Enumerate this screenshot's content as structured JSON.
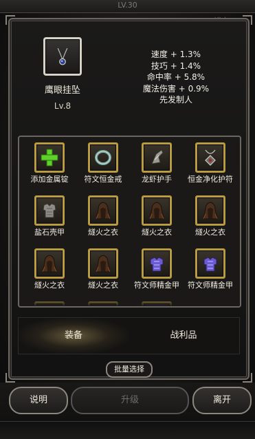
{
  "header": {
    "level": "LV.30",
    "right_text": "锁定"
  },
  "item": {
    "icon": "pendant-icon",
    "name": "鹰眼挂坠",
    "level": "Lv.8"
  },
  "stats": [
    "速度 + 1.3%",
    "技巧 + 1.4%",
    "命中率 + 5.8%",
    "魔法伤害 + 0.9%",
    "先发制人"
  ],
  "grid": [
    {
      "label": "添加金属锭",
      "icon": "plus-icon"
    },
    {
      "label": "符文恒金戒",
      "icon": "ring-icon"
    },
    {
      "label": "龙虾护手",
      "icon": "gauntlet-icon"
    },
    {
      "label": "恒金净化护符",
      "icon": "amulet-icon"
    },
    {
      "label": "盐石壳甲",
      "icon": "chest-armor-icon"
    },
    {
      "label": "燧火之衣",
      "icon": "cloak-icon"
    },
    {
      "label": "燧火之衣",
      "icon": "cloak-icon"
    },
    {
      "label": "燧火之衣",
      "icon": "cloak-icon"
    },
    {
      "label": "燧火之衣",
      "icon": "cloak-icon"
    },
    {
      "label": "燧火之衣",
      "icon": "cloak-icon"
    },
    {
      "label": "符文师精金甲",
      "icon": "rune-armor-icon"
    },
    {
      "label": "符文师精金甲",
      "icon": "rune-armor-icon"
    }
  ],
  "tabs": {
    "equipment": "装备",
    "loot": "战利品"
  },
  "batch_select": "批量选择",
  "buttons": {
    "help": "说明",
    "upgrade": "升级",
    "leave": "离开"
  },
  "colors": {
    "slot_border": "#b99c3f",
    "plus": "#5fd12b",
    "rune_purple": "#6b5ad1"
  }
}
